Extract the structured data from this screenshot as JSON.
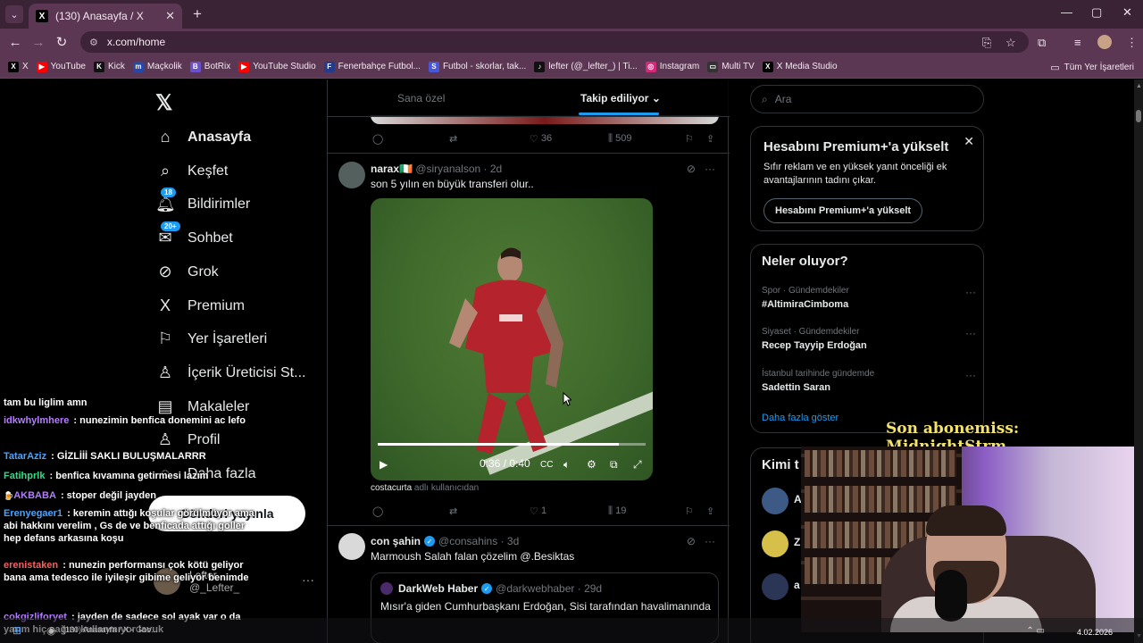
{
  "browser": {
    "tab_title": "(130) Anasayfa / X",
    "url": "x.com/home",
    "bookmarks": [
      {
        "label": "X",
        "color": "#000000",
        "glyph": "X"
      },
      {
        "label": "YouTube",
        "color": "#ff0000",
        "glyph": "▶"
      },
      {
        "label": "Kick",
        "color": "#111111",
        "glyph": "K"
      },
      {
        "label": "Maçkolik",
        "color": "#2848a8",
        "glyph": "m"
      },
      {
        "label": "BotRix",
        "color": "#6b4fd1",
        "glyph": "B"
      },
      {
        "label": "YouTube Studio",
        "color": "#ff0000",
        "glyph": "▶"
      },
      {
        "label": "Fenerbahçe Futbol...",
        "color": "#243b8a",
        "glyph": "F"
      },
      {
        "label": "Futbol - skorlar, tak...",
        "color": "#4a56d8",
        "glyph": "S"
      },
      {
        "label": "lefter (@_lefter_) | Ti...",
        "color": "#111111",
        "glyph": "♪"
      },
      {
        "label": "Instagram",
        "color": "#d6287a",
        "glyph": "◎"
      },
      {
        "label": "Multi TV",
        "color": "#333333",
        "glyph": "▭"
      },
      {
        "label": "X Media Studio",
        "color": "#000000",
        "glyph": "X"
      }
    ],
    "all_bookmarks": "Tüm Yer İşaretleri"
  },
  "nav": {
    "items": [
      {
        "label": "Anasayfa",
        "icon": "⌂"
      },
      {
        "label": "Keşfet",
        "icon": "⌕"
      },
      {
        "label": "Bildirimler",
        "icon": "🔔︎",
        "badge": "18"
      },
      {
        "label": "Sohbet",
        "icon": "✉",
        "badge": "20+"
      },
      {
        "label": "Grok",
        "icon": "⊘"
      },
      {
        "label": "Premium",
        "icon": "X"
      },
      {
        "label": "Yer İşaretleri",
        "icon": "⚐"
      },
      {
        "label": "İçerik Üreticisi St...",
        "icon": "♙"
      },
      {
        "label": "Makaleler",
        "icon": "▤"
      },
      {
        "label": "Profil",
        "icon": "♙"
      },
      {
        "label": "Daha fazla",
        "icon": "◌"
      }
    ],
    "post_button": "Gönderi yayınla",
    "account": "@_Lefter_",
    "account_name": "Lefter"
  },
  "timeline": {
    "tabs": [
      "Sana özel",
      "Takip ediliyor"
    ],
    "prev_stats": {
      "likes": "36",
      "views": "509"
    },
    "tweet1": {
      "name": "narax🇮🇪",
      "handle": "@siryanalson",
      "time": "2d",
      "text": "son 5 yılın en büyük transferi olur..",
      "video_time": "0:36 / 0:40",
      "video_progress": 0.9,
      "credit_user": "costacurta",
      "credit_suffix": "adlı kullanıcıdan",
      "likes": "1",
      "views": "19"
    },
    "tweet2": {
      "name": "con şahin",
      "handle": "@consahins",
      "time": "3d",
      "text": "Marmoush Salah falan çözelim @.Besiktas",
      "quote_name": "DarkWeb Haber",
      "quote_handle": "@darkwebhaber",
      "quote_time": "29d",
      "quote_text": "Mısır'a giden Cumhurbaşkanı Erdoğan, Sisi tarafından havalimanında"
    }
  },
  "right": {
    "search_placeholder": "Ara",
    "premium_title": "Hesabını Premium+'a yükselt",
    "premium_text": "Sıfır reklam ve en yüksek yanıt önceliği ek avantajlarının tadını çıkar.",
    "premium_button": "Hesabını Premium+'a yükselt",
    "trends_title": "Neler oluyor?",
    "trends": [
      {
        "context": "Spor · Gündemdekiler",
        "name": "#AltimiraCimboma"
      },
      {
        "context": "Siyaset · Gündemdekiler",
        "name": "Recep Tayyip Erdoğan"
      },
      {
        "context": "İstanbul tarihinde gündemde",
        "name": "Sadettin Saran"
      }
    ],
    "show_more": "Daha fazla göster",
    "follow_title": "Kimi t",
    "follow_rows": [
      {
        "initial": "A"
      },
      {
        "initial": "Z"
      },
      {
        "initial": "a"
      }
    ]
  },
  "stream": {
    "sub_banner": "Son abonemiss: MidnightStrm",
    "chat": [
      {
        "user": "",
        "color": "#ffffff",
        "text": "tam bu liglim amn"
      },
      {
        "user": "idkwhylmhere",
        "color": "#b57cff",
        "text": "nunezimin benfica donemini ac lefo"
      },
      {
        "user": "TatarAziz",
        "color": "#4aa3ff",
        "text": "GİZLİİİ SAKLI BULUŞMALARRR"
      },
      {
        "user": "Fatihprlk",
        "color": "#39d98a",
        "text": "benfica kıvamına getirmesi lazım"
      },
      {
        "user": "AKBABA",
        "color": "#b57cff",
        "text": "stoper değil jayden",
        "prefix": "🍺"
      },
      {
        "user": "Erenyegaer1",
        "color": "#4aa3ff",
        "text": "keremin attığı koşular görülmüyor ama abi hakkını verelim , Gs de ve benficada attığı goller hep defans arkasına koşu"
      },
      {
        "user": "erenistaken",
        "color": "#ff5d5d",
        "text": "nunezin performansı çok kötü geliyor bana ama tedesco ile iyileşir gibime geliyor benimde"
      },
      {
        "user": "cokgizliforyet",
        "color": "#b57cff",
        "text": "jayden de sadece sol ayak var o da yarım hiç sağını kullanmıyor lavuk"
      }
    ],
    "taskbar_title": "(130) Anasayfa / X - Goo...",
    "date": "4.02.2026"
  }
}
